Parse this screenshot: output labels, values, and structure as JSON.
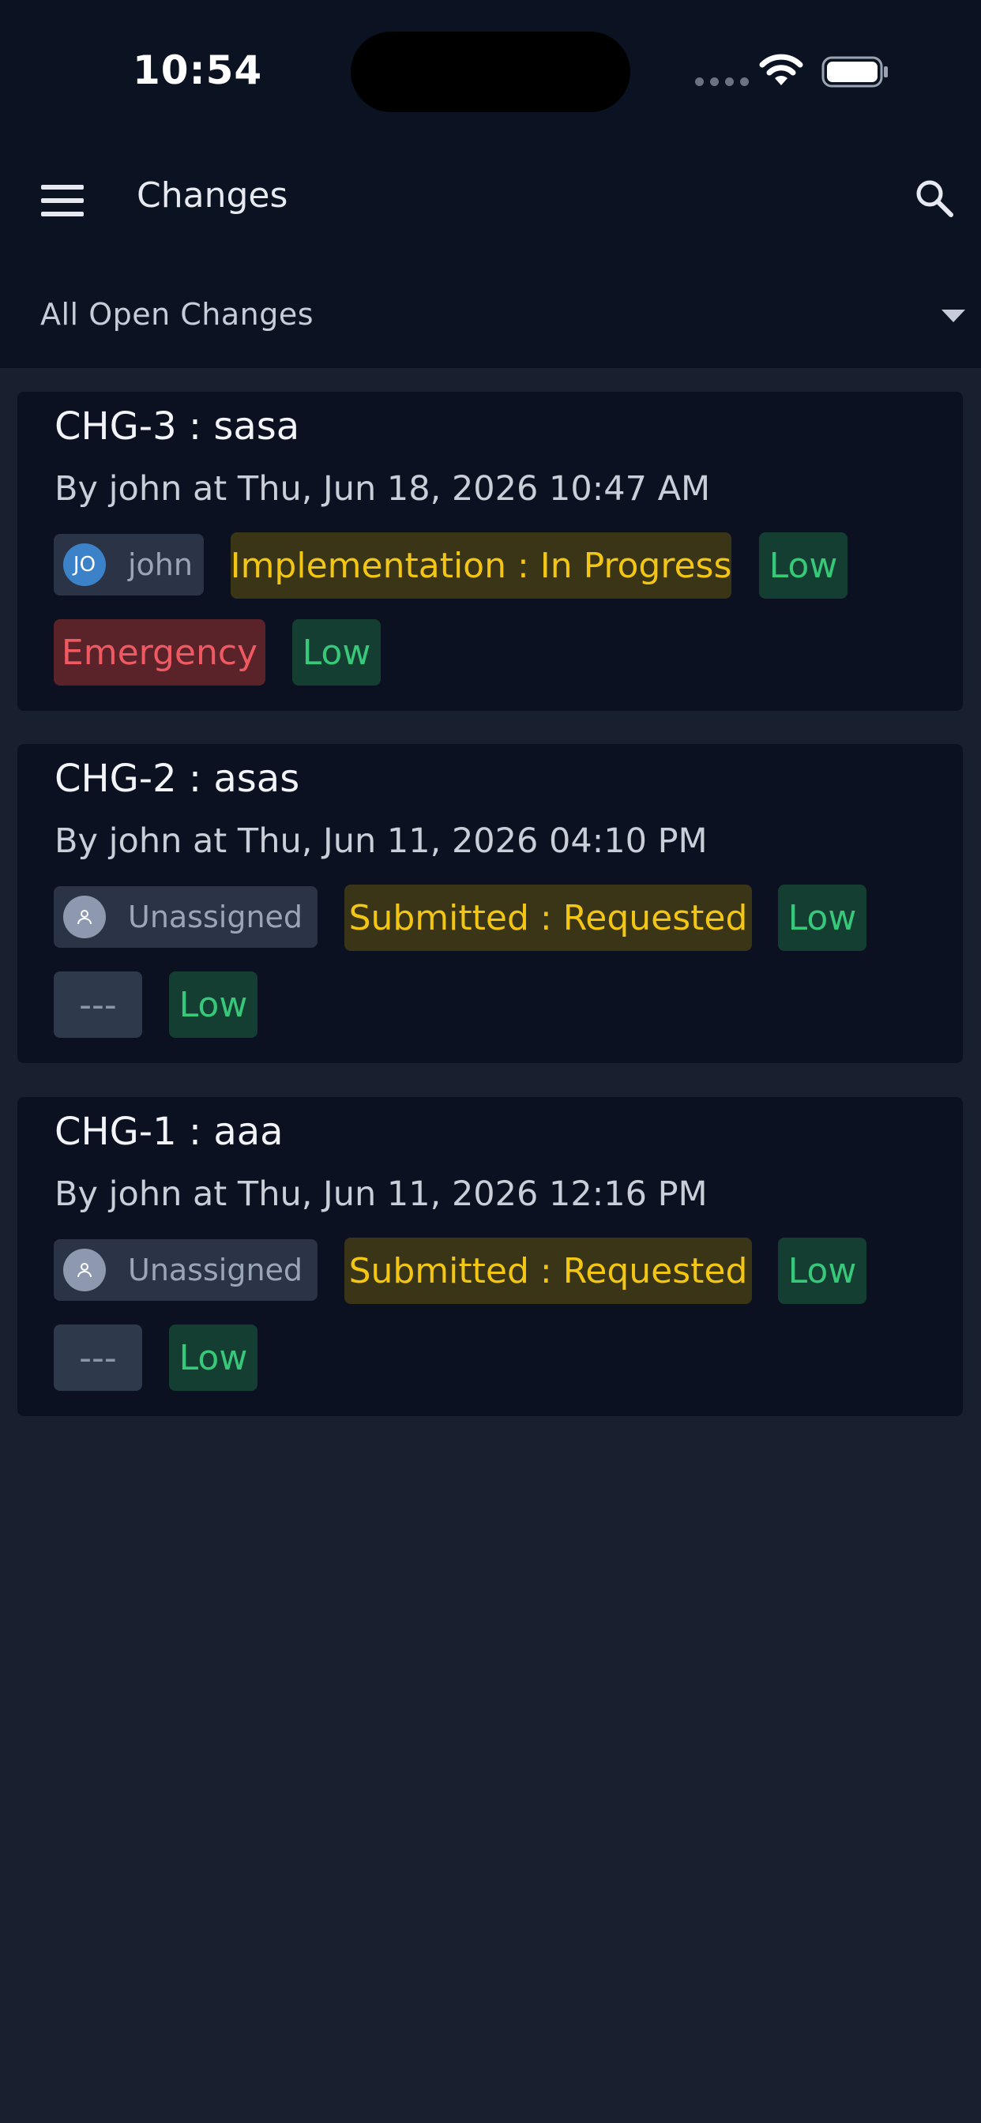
{
  "status_bar": {
    "time": "10:54"
  },
  "header": {
    "title": "Changes"
  },
  "filter": {
    "selected": "All Open Changes"
  },
  "changes": [
    {
      "title": "CHG-3 : sasa",
      "subtitle": "By john at Thu, Jun 18, 2026 10:47 AM",
      "assignee": {
        "initials": "JO",
        "name": "john"
      },
      "status": "Implementation : In Progress",
      "priority": "Low",
      "type": "Emergency",
      "risk": "Low"
    },
    {
      "title": "CHG-2 : asas",
      "subtitle": "By john at Thu, Jun 11, 2026 04:10 PM",
      "assignee": {
        "name": "Unassigned"
      },
      "status": "Submitted : Requested",
      "priority": "Low",
      "type": "---",
      "risk": "Low"
    },
    {
      "title": "CHG-1 : aaa",
      "subtitle": "By john at Thu, Jun 11, 2026 12:16 PM",
      "assignee": {
        "name": "Unassigned"
      },
      "status": "Submitted : Requested",
      "priority": "Low",
      "type": "---",
      "risk": "Low"
    }
  ]
}
